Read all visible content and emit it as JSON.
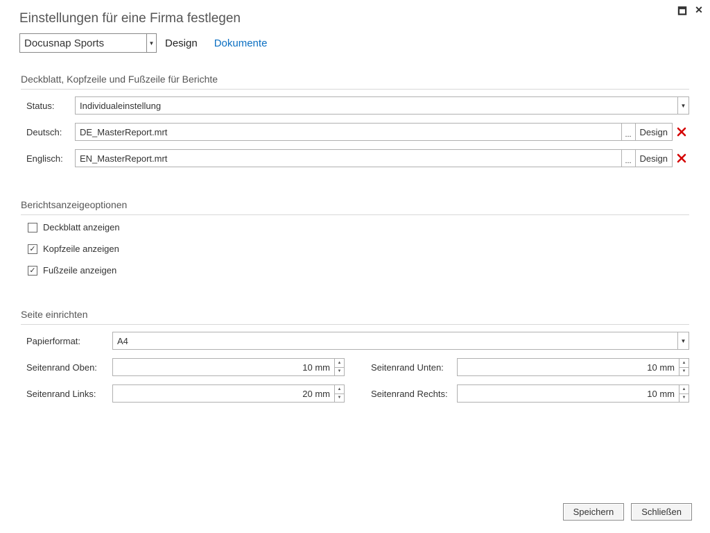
{
  "title": "Einstellungen für eine Firma festlegen",
  "company_selected": "Docusnap Sports",
  "tabs": {
    "design": "Design",
    "documents": "Dokumente"
  },
  "sections": {
    "cover": "Deckblatt, Kopfzeile und Fußzeile für Berichte",
    "display": "Berichtsanzeigeoptionen",
    "page": "Seite einrichten"
  },
  "labels": {
    "status": "Status:",
    "german": "Deutsch:",
    "english": "Englisch:",
    "paper": "Papierformat:",
    "margin_top": "Seitenrand Oben:",
    "margin_bottom": "Seitenrand Unten:",
    "margin_left": "Seitenrand Links:",
    "margin_right": "Seitenrand Rechts:"
  },
  "values": {
    "status": "Individualeinstellung",
    "german": "DE_MasterReport.mrt",
    "english": "EN_MasterReport.mrt",
    "paper": "A4",
    "margin_top": "10 mm",
    "margin_bottom": "10 mm",
    "margin_left": "20 mm",
    "margin_right": "10 mm"
  },
  "checkboxes": {
    "cover": {
      "label": "Deckblatt anzeigen",
      "checked": false
    },
    "header": {
      "label": "Kopfzeile anzeigen",
      "checked": true
    },
    "footer": {
      "label": "Fußzeile anzeigen",
      "checked": true
    }
  },
  "buttons": {
    "browse": "...",
    "design": "Design",
    "save": "Speichern",
    "close": "Schließen"
  }
}
